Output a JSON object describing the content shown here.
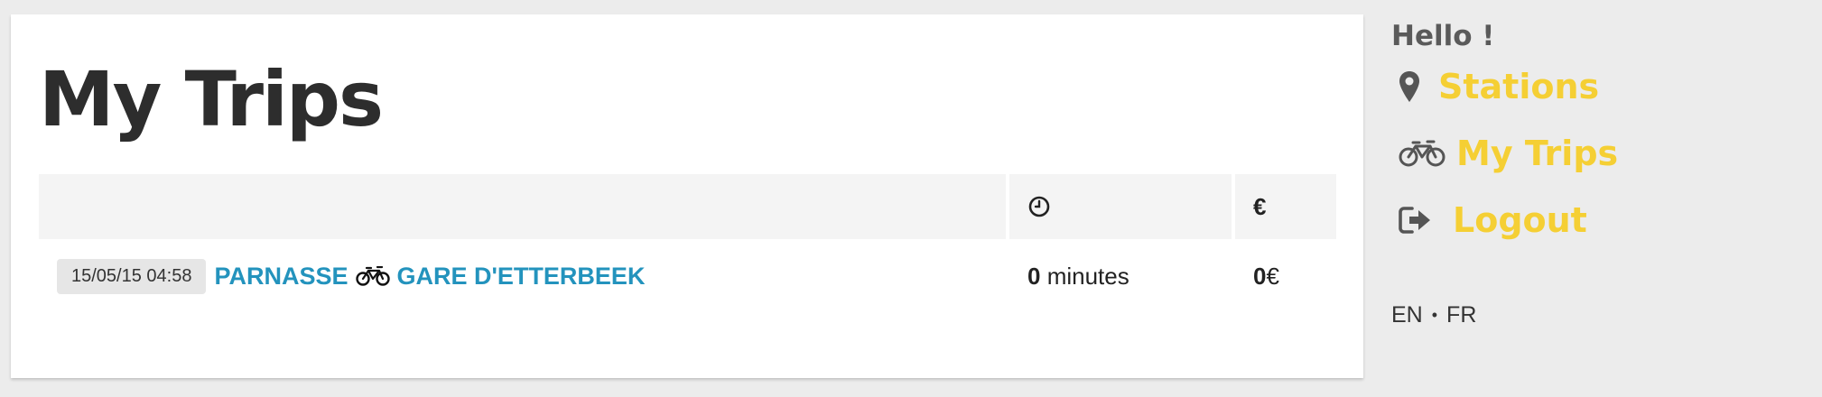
{
  "main": {
    "title": "My Trips",
    "table": {
      "header_icons": {
        "duration": "clock-icon",
        "price": "€"
      },
      "rows": [
        {
          "date": "15/05/15 04:58",
          "from": "PARNASSE",
          "to": "GARE D'ETTERBEEK",
          "duration_value": "0",
          "duration_unit": "minutes",
          "price_value": "0",
          "price_currency": "€"
        }
      ]
    }
  },
  "sidebar": {
    "greeting": "Hello !",
    "nav": [
      {
        "icon": "map-pin-icon",
        "label": "Stations"
      },
      {
        "icon": "bicycle-icon",
        "label": "My Trips"
      },
      {
        "icon": "logout-icon",
        "label": "Logout"
      }
    ],
    "languages": [
      "EN",
      "FR"
    ],
    "language_separator": "•"
  },
  "colors": {
    "link": "#2393bd",
    "nav_accent": "#f5cf34",
    "background": "#ececec",
    "card": "#ffffff",
    "table_header": "#f4f4f4"
  }
}
